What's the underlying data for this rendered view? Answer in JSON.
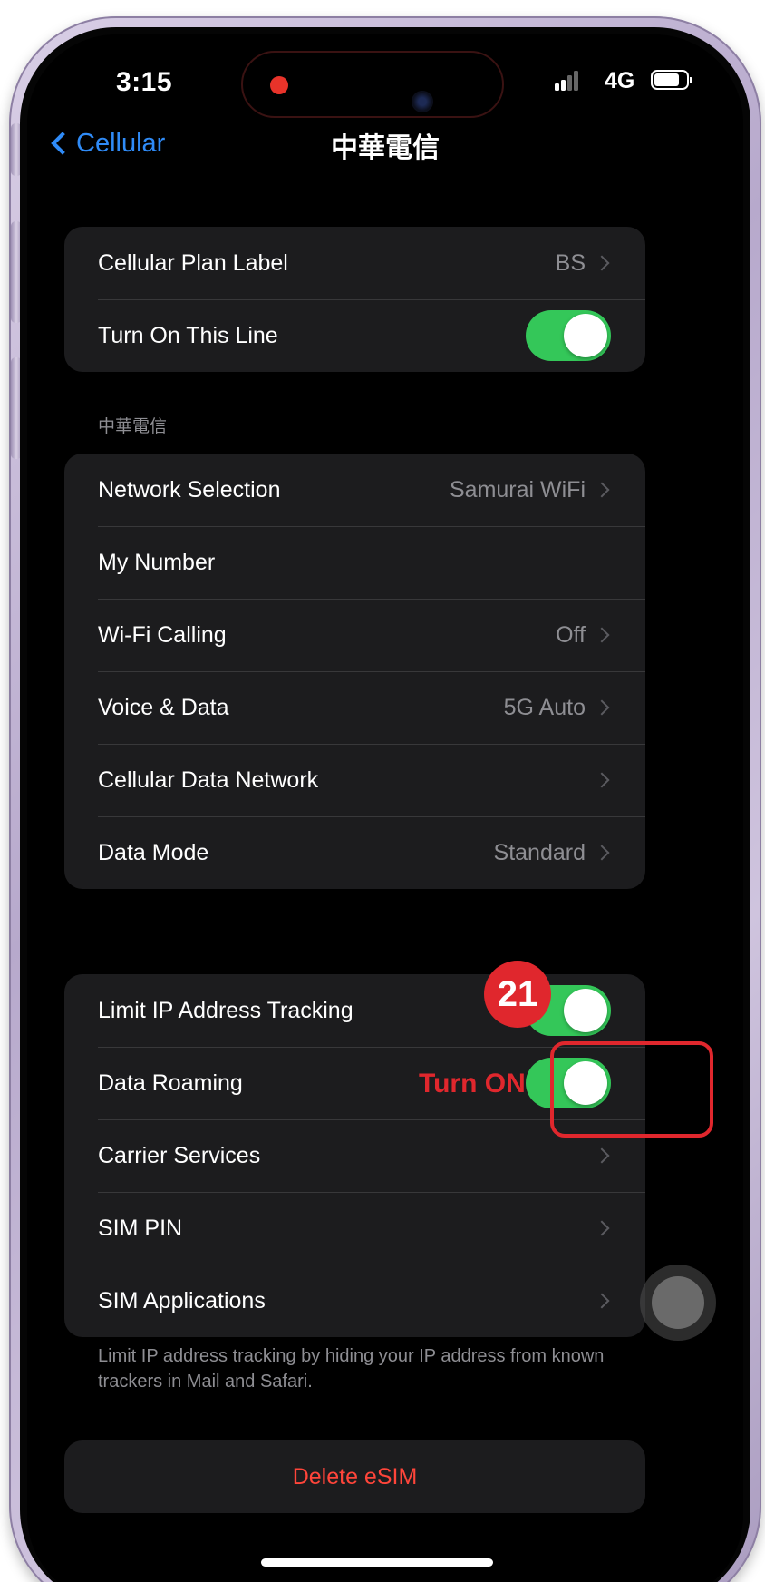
{
  "status_bar": {
    "time": "3:15",
    "network": "4G"
  },
  "nav": {
    "back_label": "Cellular",
    "title": "中華電信"
  },
  "group1": [
    {
      "label": "Cellular Plan Label",
      "value": "BS"
    },
    {
      "label": "Turn On This Line",
      "toggle": "on"
    }
  ],
  "section_header": "中華電信",
  "group2": [
    {
      "label": "Network Selection",
      "value": "Samurai WiFi"
    },
    {
      "label": "My Number"
    },
    {
      "label": "Wi-Fi Calling",
      "value": "Off"
    },
    {
      "label": "Voice & Data",
      "value": "5G Auto"
    },
    {
      "label": "Cellular Data Network"
    },
    {
      "label": "Data Mode",
      "value": "Standard"
    }
  ],
  "group3": [
    {
      "label": "Limit IP Address Tracking",
      "toggle": "on"
    },
    {
      "label": "Data Roaming",
      "toggle": "on"
    },
    {
      "label": "Carrier Services"
    },
    {
      "label": "SIM PIN"
    },
    {
      "label": "SIM Applications"
    }
  ],
  "footnote": "Limit IP address tracking by hiding your IP address from known trackers in Mail and Safari.",
  "delete_label": "Delete eSIM",
  "annotation": {
    "step": "21",
    "instruction": "Turn ON",
    "color": "#e0272d"
  },
  "colors": {
    "accent": "#2f8bf7",
    "toggle_on": "#34c759",
    "destructive": "#ff453a"
  }
}
